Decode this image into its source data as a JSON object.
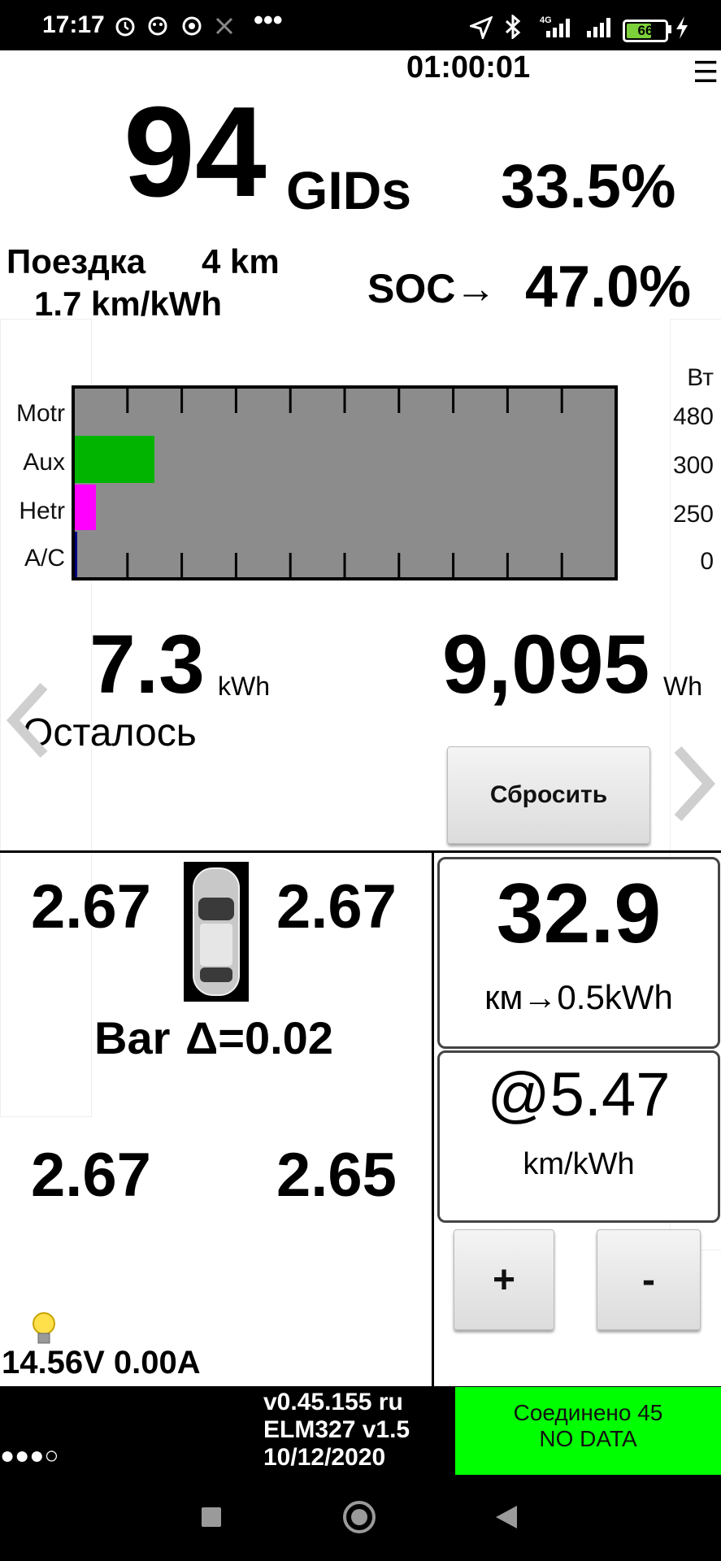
{
  "status_bar": {
    "time": "17:17",
    "dots": "•••",
    "battery": "66",
    "network": "4G"
  },
  "top": {
    "clock": "01:00:01",
    "menu_icon": "☰",
    "gids_value": "94",
    "gids_unit": "GIDs",
    "percent": "33.5%",
    "trip_label": "Поездка",
    "trip_distance": "4 km",
    "trip_efficiency": "1.7 km/kWh",
    "soc_label": "SOC→",
    "soc_value": "47.0%"
  },
  "power_chart": {
    "unit": "Вт",
    "rows": [
      {
        "label": "Motr",
        "value": "480"
      },
      {
        "label": "Aux",
        "value": "300"
      },
      {
        "label": "Hetr",
        "value": "250"
      },
      {
        "label": "A/C",
        "value": "0"
      }
    ],
    "colors": {
      "background": "#8c8c8c",
      "aux": "#00b400",
      "hetr": "#ff00ff",
      "ac": "#000080"
    }
  },
  "energy": {
    "kwh_value": "7.3",
    "kwh_unit": "kWh",
    "wh_value": "9,095",
    "wh_unit": "Wh",
    "remaining_label": "Осталось",
    "reset_label": "Сбросить"
  },
  "tires": {
    "front_left": "2.67",
    "front_right": "2.67",
    "rear_left": "2.67",
    "rear_right": "2.65",
    "unit": "Bar",
    "delta": "Δ=0.02"
  },
  "range": {
    "value": "32.9",
    "label": "км→0.5kWh",
    "efficiency": "@5.47",
    "efficiency_unit": "km/kWh",
    "plus_label": "+",
    "minus_label": "-"
  },
  "voltage": {
    "text": "14.56V 0.00A"
  },
  "footer": {
    "dots": "●●●○",
    "version": "v0.45.155 ru",
    "adapter": "ELM327 v1.5",
    "date": "10/12/2020",
    "connection": "Соединено 45",
    "data_status": "NO DATA",
    "connection_color": "#00ff00"
  }
}
